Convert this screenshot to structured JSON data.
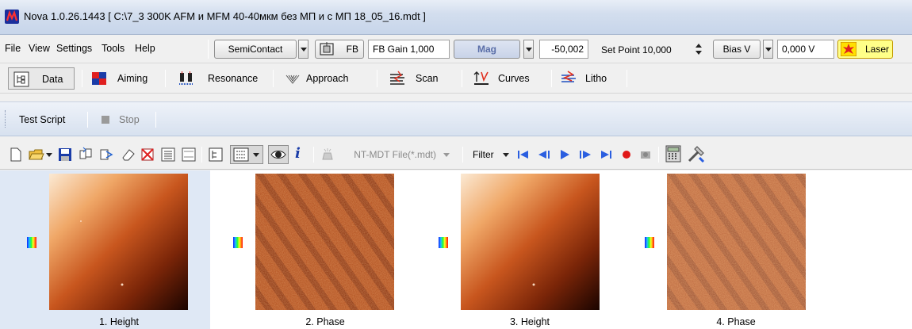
{
  "window": {
    "title": "Nova  1.0.26.1443  [ C:\\7_3 300K AFM и MFM 40-40мкм без МП и с МП 18_05_16.mdt ]"
  },
  "menu": [
    "File",
    "View",
    "Settings",
    "Tools",
    "Help"
  ],
  "controls": {
    "mode": "SemiContact",
    "fb_label": "FB",
    "fb_gain": "FB Gain 1,000",
    "signal": "Mag",
    "signal_value": "-50,002",
    "set_point": "Set Point 10,000",
    "bias_mode": "Bias V",
    "bias_value": "0,000  V",
    "laser": "Laser"
  },
  "tabs": [
    {
      "label": "Data",
      "icon": "data-icon"
    },
    {
      "label": "Aiming",
      "icon": "aiming-icon"
    },
    {
      "label": "Resonance",
      "icon": "resonance-icon"
    },
    {
      "label": "Approach",
      "icon": "approach-icon"
    },
    {
      "label": "Scan",
      "icon": "scan-icon"
    },
    {
      "label": "Curves",
      "icon": "curves-icon"
    },
    {
      "label": "Litho",
      "icon": "litho-icon"
    }
  ],
  "script": {
    "run": "Test Script",
    "stop": "Stop"
  },
  "file_toolbar": {
    "file_type": "NT-MDT File(*.mdt)",
    "filter": "Filter"
  },
  "gallery": [
    {
      "caption": "1. Height",
      "kind": "height"
    },
    {
      "caption": "2. Phase",
      "kind": "phase"
    },
    {
      "caption": "3. Height",
      "kind": "height"
    },
    {
      "caption": "4. Phase",
      "kind": "phase"
    }
  ],
  "colors": {
    "height_light": "#f6e1c8",
    "height_dark": "#1e0500",
    "phase_base": "#b4521f",
    "selection": "#dfe8f5"
  }
}
